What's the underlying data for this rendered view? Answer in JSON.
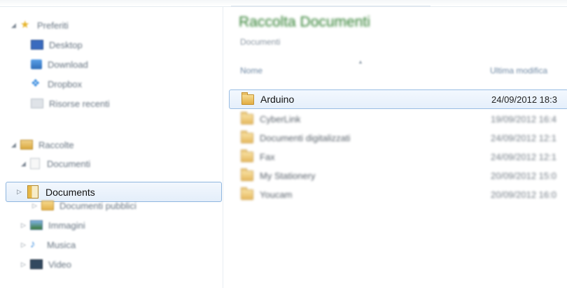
{
  "nav": {
    "favorites": {
      "label": "Preferiti",
      "items": [
        {
          "label": "Desktop",
          "icon": "desktop-icon"
        },
        {
          "label": "Download",
          "icon": "download-icon"
        },
        {
          "label": "Dropbox",
          "icon": "dropbox-icon"
        },
        {
          "label": "Risorse recenti",
          "icon": "recent-places-icon"
        }
      ]
    },
    "libraries": {
      "label": "Raccolte",
      "documenti": "Documenti",
      "documents_selected": "Documents",
      "public_docs": "Documenti pubblici",
      "immagini": "Immagini",
      "musica": "Musica",
      "video": "Video"
    }
  },
  "content": {
    "title": "Raccolta Documenti",
    "subtitle": "Documenti",
    "columns": {
      "name": "Nome",
      "modified": "Ultima modifica"
    },
    "files": [
      {
        "name": "Arduino",
        "date": "24/09/2012 18:3",
        "selected": true
      },
      {
        "name": "CyberLink",
        "date": "19/09/2012 16:4"
      },
      {
        "name": "Documenti digitalizzati",
        "date": "24/09/2012 12:1"
      },
      {
        "name": "Fax",
        "date": "24/09/2012 12:1"
      },
      {
        "name": "My Stationery",
        "date": "20/09/2012 15:0"
      },
      {
        "name": "Youcam",
        "date": "20/09/2012 16:0"
      }
    ]
  },
  "colors": {
    "title_green": "#2c7d2c",
    "selection_border": "#99bde3",
    "selection_fill": "#e5effb"
  }
}
